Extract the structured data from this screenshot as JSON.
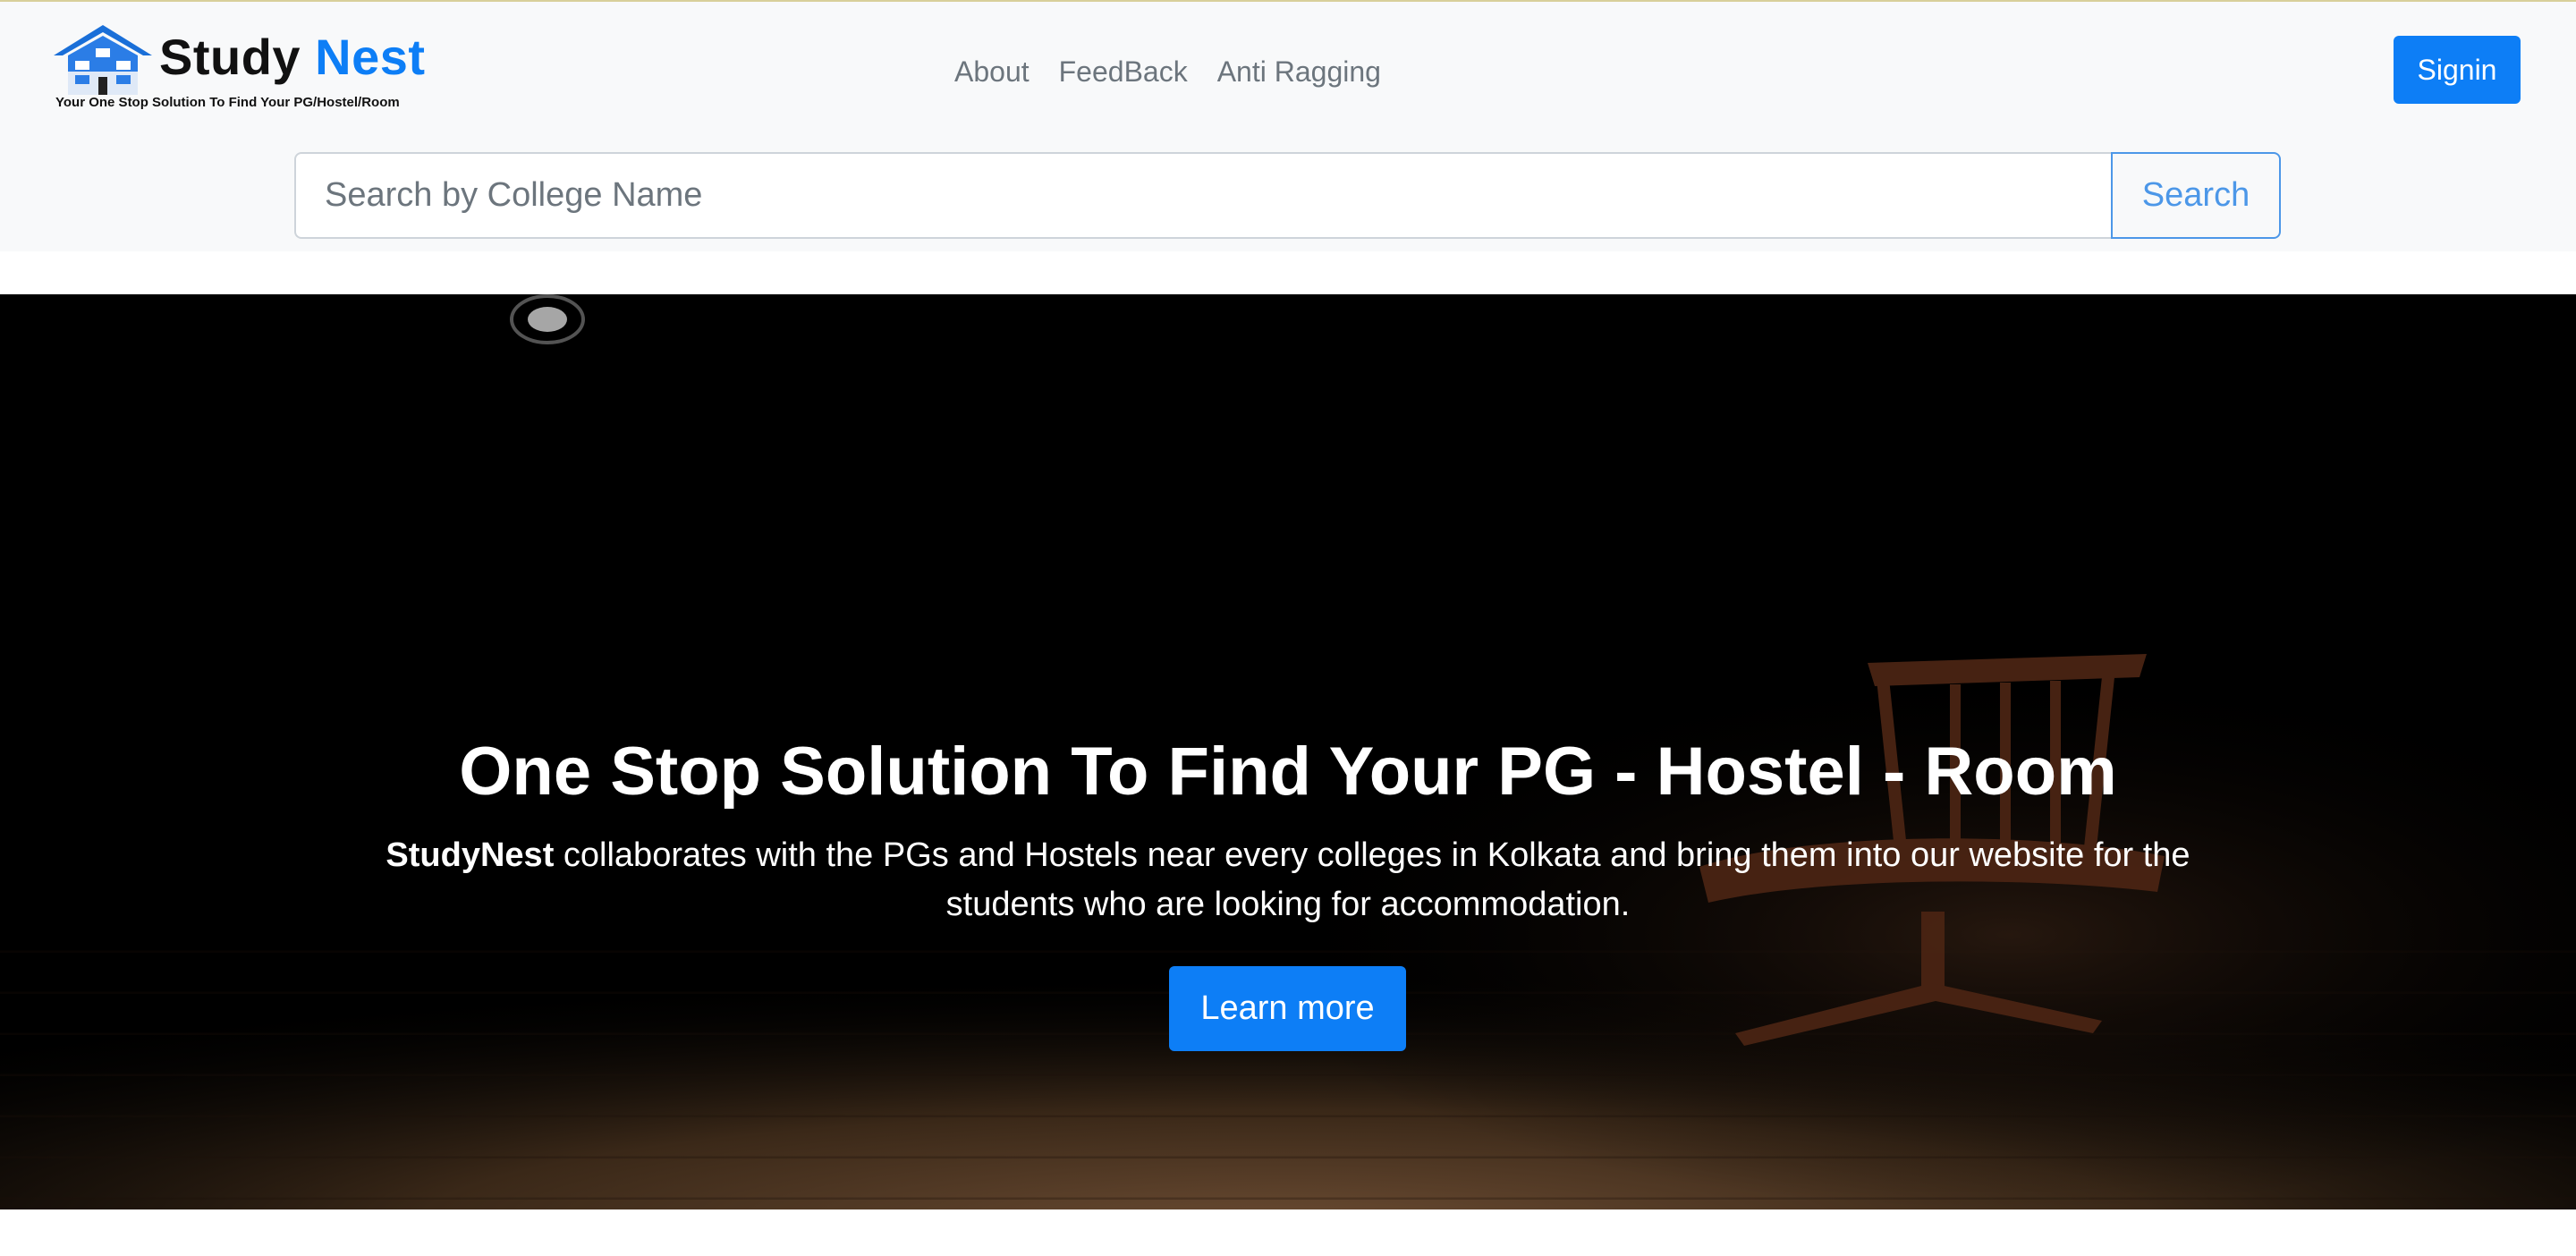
{
  "brand": {
    "name_part1": "Study ",
    "name_part2": "Nest",
    "tagline": "Your One Stop Solution To Find Your PG/Hostel/Room",
    "logo_icon": "house-icon"
  },
  "nav": {
    "links": [
      "About",
      "FeedBack",
      "Anti Ragging"
    ],
    "signin_label": "Signin"
  },
  "search": {
    "placeholder": "Search by College Name",
    "value": "",
    "button_label": "Search"
  },
  "hero": {
    "title": "One Stop Solution To Find Your PG - Hostel - Room",
    "desc_bold": "StudyNest",
    "desc_rest": " collaborates with the PGs and Hostels near every colleges in Kolkata and bring them into our website for the students who are looking for accommodation.",
    "cta_label": "Learn more",
    "background_image": "dark-room-wooden-chair"
  },
  "colors": {
    "primary": "#0d7ef6",
    "navbar_bg": "#f8f9fa",
    "nav_link": "#6c757d"
  }
}
